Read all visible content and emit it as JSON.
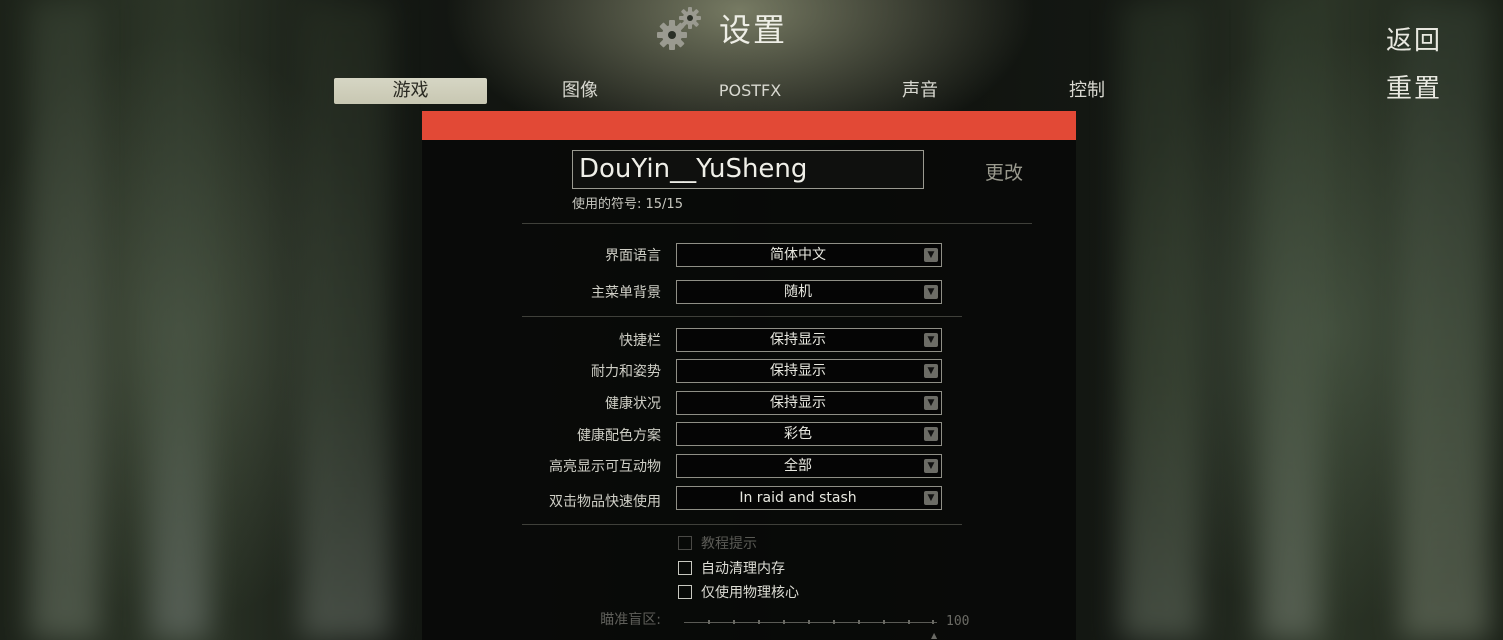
{
  "header": {
    "title": "设置",
    "icon": "gears-icon"
  },
  "actions": {
    "back": "返回",
    "reset": "重置"
  },
  "tabs": [
    {
      "label": "游戏",
      "active": true
    },
    {
      "label": "图像",
      "active": false
    },
    {
      "label": "POSTFX",
      "active": false
    },
    {
      "label": "声音",
      "active": false
    },
    {
      "label": "控制",
      "active": false
    }
  ],
  "colors": {
    "accent_bar": "#e24936"
  },
  "profile": {
    "nickname": "DouYin__YuSheng",
    "change_label": "更改",
    "symbols_used": "使用的符号: 15/15"
  },
  "settings_group1": [
    {
      "label": "界面语言",
      "value": "简体中文"
    },
    {
      "label": "主菜单背景",
      "value": "随机"
    }
  ],
  "settings_group2": [
    {
      "label": "快捷栏",
      "value": "保持显示"
    },
    {
      "label": "耐力和姿势",
      "value": "保持显示"
    },
    {
      "label": "健康状况",
      "value": "保持显示"
    },
    {
      "label": "健康配色方案",
      "value": "彩色"
    },
    {
      "label": "高亮显示可互动物",
      "value": "全部"
    },
    {
      "label": "双击物品快速使用",
      "value": "In raid and stash"
    }
  ],
  "checkboxes": [
    {
      "label": "教程提示",
      "checked": false,
      "disabled": true
    },
    {
      "label": "自动清理内存",
      "checked": false,
      "disabled": false
    },
    {
      "label": "仅使用物理核心",
      "checked": false,
      "disabled": false
    }
  ],
  "slider": {
    "label": "瞄准盲区:",
    "value": "100"
  }
}
